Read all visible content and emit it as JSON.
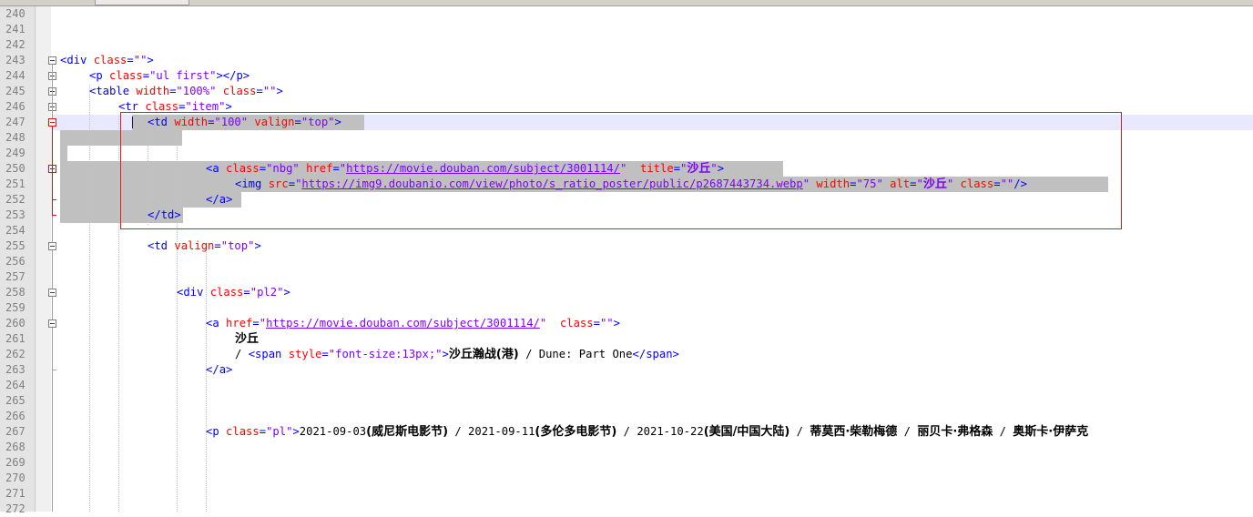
{
  "colors": {
    "tag": "#0000ff",
    "attribute": "#ff0000",
    "string": "#8000ff",
    "text": "#000000",
    "line_number": "#808080",
    "selection": "#c0c0c0",
    "current_line": "#e8e8ff",
    "annotation_box": "#e02020"
  },
  "editor": {
    "lines": [
      {
        "num": "240",
        "indent": 0,
        "tokens": []
      },
      {
        "num": "241",
        "indent": 0,
        "tokens": []
      },
      {
        "num": "242",
        "indent": 0,
        "tokens": []
      },
      {
        "num": "243",
        "indent": 0,
        "tokens": [
          {
            "t": "<",
            "k": "punc"
          },
          {
            "t": "div",
            "k": "tag"
          },
          {
            "t": " class",
            "k": "attr"
          },
          {
            "t": "=",
            "k": "punc"
          },
          {
            "t": "\"\"",
            "k": "str"
          },
          {
            "t": ">",
            "k": "punc"
          }
        ]
      },
      {
        "num": "244",
        "indent": 1,
        "tokens": [
          {
            "t": "<",
            "k": "punc"
          },
          {
            "t": "p",
            "k": "tag"
          },
          {
            "t": " class",
            "k": "attr"
          },
          {
            "t": "=",
            "k": "punc"
          },
          {
            "t": "\"ul first\"",
            "k": "str"
          },
          {
            "t": "></",
            "k": "punc"
          },
          {
            "t": "p",
            "k": "tag"
          },
          {
            "t": ">",
            "k": "punc"
          }
        ]
      },
      {
        "num": "245",
        "indent": 1,
        "tokens": [
          {
            "t": "<",
            "k": "punc"
          },
          {
            "t": "table",
            "k": "tag"
          },
          {
            "t": " width",
            "k": "attr"
          },
          {
            "t": "=",
            "k": "punc"
          },
          {
            "t": "\"100%\"",
            "k": "str"
          },
          {
            "t": " class",
            "k": "attr"
          },
          {
            "t": "=",
            "k": "punc"
          },
          {
            "t": "\"\"",
            "k": "str"
          },
          {
            "t": ">",
            "k": "punc"
          }
        ]
      },
      {
        "num": "246",
        "indent": 2,
        "tokens": [
          {
            "t": "<",
            "k": "punc"
          },
          {
            "t": "tr",
            "k": "tag"
          },
          {
            "t": " class",
            "k": "attr"
          },
          {
            "t": "=",
            "k": "punc"
          },
          {
            "t": "\"item\"",
            "k": "str"
          },
          {
            "t": ">",
            "k": "punc"
          }
        ]
      },
      {
        "num": "247",
        "indent": 3,
        "tokens": [
          {
            "t": "<",
            "k": "punc"
          },
          {
            "t": "td",
            "k": "tag"
          },
          {
            "t": " width",
            "k": "attr"
          },
          {
            "t": "=",
            "k": "punc"
          },
          {
            "t": "\"100\"",
            "k": "str"
          },
          {
            "t": " valign",
            "k": "attr"
          },
          {
            "t": "=",
            "k": "punc"
          },
          {
            "t": "\"top\"",
            "k": "str"
          },
          {
            "t": ">",
            "k": "punc"
          }
        ]
      },
      {
        "num": "248",
        "indent": 0,
        "tokens": []
      },
      {
        "num": "249",
        "indent": 0,
        "tokens": []
      },
      {
        "num": "250",
        "indent": 5,
        "tokens": [
          {
            "t": "<",
            "k": "punc"
          },
          {
            "t": "a",
            "k": "tag"
          },
          {
            "t": " class",
            "k": "attr"
          },
          {
            "t": "=",
            "k": "punc"
          },
          {
            "t": "\"nbg\"",
            "k": "str"
          },
          {
            "t": " href",
            "k": "attr"
          },
          {
            "t": "=",
            "k": "punc"
          },
          {
            "t": "\"",
            "k": "str"
          },
          {
            "t": "https://movie.douban.com/subject/3001114/",
            "k": "url"
          },
          {
            "t": "\"",
            "k": "str"
          },
          {
            "t": "  title",
            "k": "attr"
          },
          {
            "t": "=",
            "k": "punc"
          },
          {
            "t": "\"",
            "k": "str"
          },
          {
            "t": "沙丘",
            "k": "str",
            "cjk": true
          },
          {
            "t": "\"",
            "k": "str"
          },
          {
            "t": ">",
            "k": "punc"
          }
        ]
      },
      {
        "num": "251",
        "indent": 6,
        "tokens": [
          {
            "t": "<",
            "k": "punc"
          },
          {
            "t": "img",
            "k": "tag"
          },
          {
            "t": " src",
            "k": "attr"
          },
          {
            "t": "=",
            "k": "punc"
          },
          {
            "t": "\"",
            "k": "str"
          },
          {
            "t": "https://img9.doubanio.com/view/photo/s_ratio_poster/public/p2687443734.webp",
            "k": "url"
          },
          {
            "t": "\"",
            "k": "str"
          },
          {
            "t": " width",
            "k": "attr"
          },
          {
            "t": "=",
            "k": "punc"
          },
          {
            "t": "\"75\"",
            "k": "str"
          },
          {
            "t": " alt",
            "k": "attr"
          },
          {
            "t": "=",
            "k": "punc"
          },
          {
            "t": "\"",
            "k": "str"
          },
          {
            "t": "沙丘",
            "k": "str",
            "cjk": true
          },
          {
            "t": "\"",
            "k": "str"
          },
          {
            "t": " class",
            "k": "attr"
          },
          {
            "t": "=",
            "k": "punc"
          },
          {
            "t": "\"\"",
            "k": "str"
          },
          {
            "t": "/>",
            "k": "punc"
          }
        ]
      },
      {
        "num": "252",
        "indent": 5,
        "tokens": [
          {
            "t": "</",
            "k": "punc"
          },
          {
            "t": "a",
            "k": "tag"
          },
          {
            "t": ">",
            "k": "punc"
          }
        ]
      },
      {
        "num": "253",
        "indent": 3,
        "tokens": [
          {
            "t": "</",
            "k": "punc"
          },
          {
            "t": "td",
            "k": "tag"
          },
          {
            "t": ">",
            "k": "punc"
          }
        ]
      },
      {
        "num": "254",
        "indent": 0,
        "tokens": []
      },
      {
        "num": "255",
        "indent": 3,
        "tokens": [
          {
            "t": "<",
            "k": "punc"
          },
          {
            "t": "td",
            "k": "tag"
          },
          {
            "t": " valign",
            "k": "attr"
          },
          {
            "t": "=",
            "k": "punc"
          },
          {
            "t": "\"top\"",
            "k": "str"
          },
          {
            "t": ">",
            "k": "punc"
          }
        ]
      },
      {
        "num": "256",
        "indent": 0,
        "tokens": []
      },
      {
        "num": "257",
        "indent": 0,
        "tokens": []
      },
      {
        "num": "258",
        "indent": 4,
        "tokens": [
          {
            "t": "<",
            "k": "punc"
          },
          {
            "t": "div",
            "k": "tag"
          },
          {
            "t": " class",
            "k": "attr"
          },
          {
            "t": "=",
            "k": "punc"
          },
          {
            "t": "\"pl2\"",
            "k": "str"
          },
          {
            "t": ">",
            "k": "punc"
          }
        ]
      },
      {
        "num": "259",
        "indent": 0,
        "tokens": []
      },
      {
        "num": "260",
        "indent": 5,
        "tokens": [
          {
            "t": "<",
            "k": "punc"
          },
          {
            "t": "a",
            "k": "tag"
          },
          {
            "t": " href",
            "k": "attr"
          },
          {
            "t": "=",
            "k": "punc"
          },
          {
            "t": "\"",
            "k": "str"
          },
          {
            "t": "https://movie.douban.com/subject/3001114/",
            "k": "url"
          },
          {
            "t": "\"",
            "k": "str"
          },
          {
            "t": "  class",
            "k": "attr"
          },
          {
            "t": "=",
            "k": "punc"
          },
          {
            "t": "\"\"",
            "k": "str"
          },
          {
            "t": ">",
            "k": "punc"
          }
        ]
      },
      {
        "num": "261",
        "indent": 6,
        "tokens": [
          {
            "t": "沙丘",
            "k": "text",
            "cjk": true
          }
        ]
      },
      {
        "num": "262",
        "indent": 6,
        "tokens": [
          {
            "t": "/ ",
            "k": "text"
          },
          {
            "t": "<",
            "k": "punc"
          },
          {
            "t": "span",
            "k": "tag"
          },
          {
            "t": " style",
            "k": "attr"
          },
          {
            "t": "=",
            "k": "punc"
          },
          {
            "t": "\"font-size:13px;\"",
            "k": "str"
          },
          {
            "t": ">",
            "k": "punc"
          },
          {
            "t": "沙丘瀚战(港)",
            "k": "text",
            "cjk": true
          },
          {
            "t": " / Dune: Part One",
            "k": "text"
          },
          {
            "t": "</",
            "k": "punc"
          },
          {
            "t": "span",
            "k": "tag"
          },
          {
            "t": ">",
            "k": "punc"
          }
        ]
      },
      {
        "num": "263",
        "indent": 5,
        "tokens": [
          {
            "t": "</",
            "k": "punc"
          },
          {
            "t": "a",
            "k": "tag"
          },
          {
            "t": ">",
            "k": "punc"
          }
        ]
      },
      {
        "num": "264",
        "indent": 0,
        "tokens": []
      },
      {
        "num": "265",
        "indent": 0,
        "tokens": []
      },
      {
        "num": "266",
        "indent": 0,
        "tokens": []
      },
      {
        "num": "267",
        "indent": 5,
        "tokens": [
          {
            "t": "<",
            "k": "punc"
          },
          {
            "t": "p",
            "k": "tag"
          },
          {
            "t": " class",
            "k": "attr"
          },
          {
            "t": "=",
            "k": "punc"
          },
          {
            "t": "\"pl\"",
            "k": "str"
          },
          {
            "t": ">",
            "k": "punc"
          },
          {
            "t": "2021-09-03",
            "k": "text"
          },
          {
            "t": "(威尼斯电影节)",
            "k": "text",
            "cjk": true
          },
          {
            "t": " / 2021-09-11",
            "k": "text"
          },
          {
            "t": "(多伦多电影节)",
            "k": "text",
            "cjk": true
          },
          {
            "t": " / 2021-10-22",
            "k": "text"
          },
          {
            "t": "(美国/中国大陆)",
            "k": "text",
            "cjk": true
          },
          {
            "t": " / ",
            "k": "text"
          },
          {
            "t": "蒂莫西·柴勒梅德",
            "k": "text",
            "cjk": true
          },
          {
            "t": " / ",
            "k": "text"
          },
          {
            "t": "丽贝卡·弗格森",
            "k": "text",
            "cjk": true
          },
          {
            "t": " / ",
            "k": "text"
          },
          {
            "t": "奥斯卡·伊萨克",
            "k": "text",
            "cjk": true
          }
        ]
      },
      {
        "num": "268",
        "indent": 0,
        "tokens": []
      },
      {
        "num": "269",
        "indent": 0,
        "tokens": []
      },
      {
        "num": "270",
        "indent": 0,
        "tokens": []
      },
      {
        "num": "271",
        "indent": 0,
        "tokens": []
      },
      {
        "num": "272",
        "indent": 0,
        "tokens": []
      }
    ]
  }
}
